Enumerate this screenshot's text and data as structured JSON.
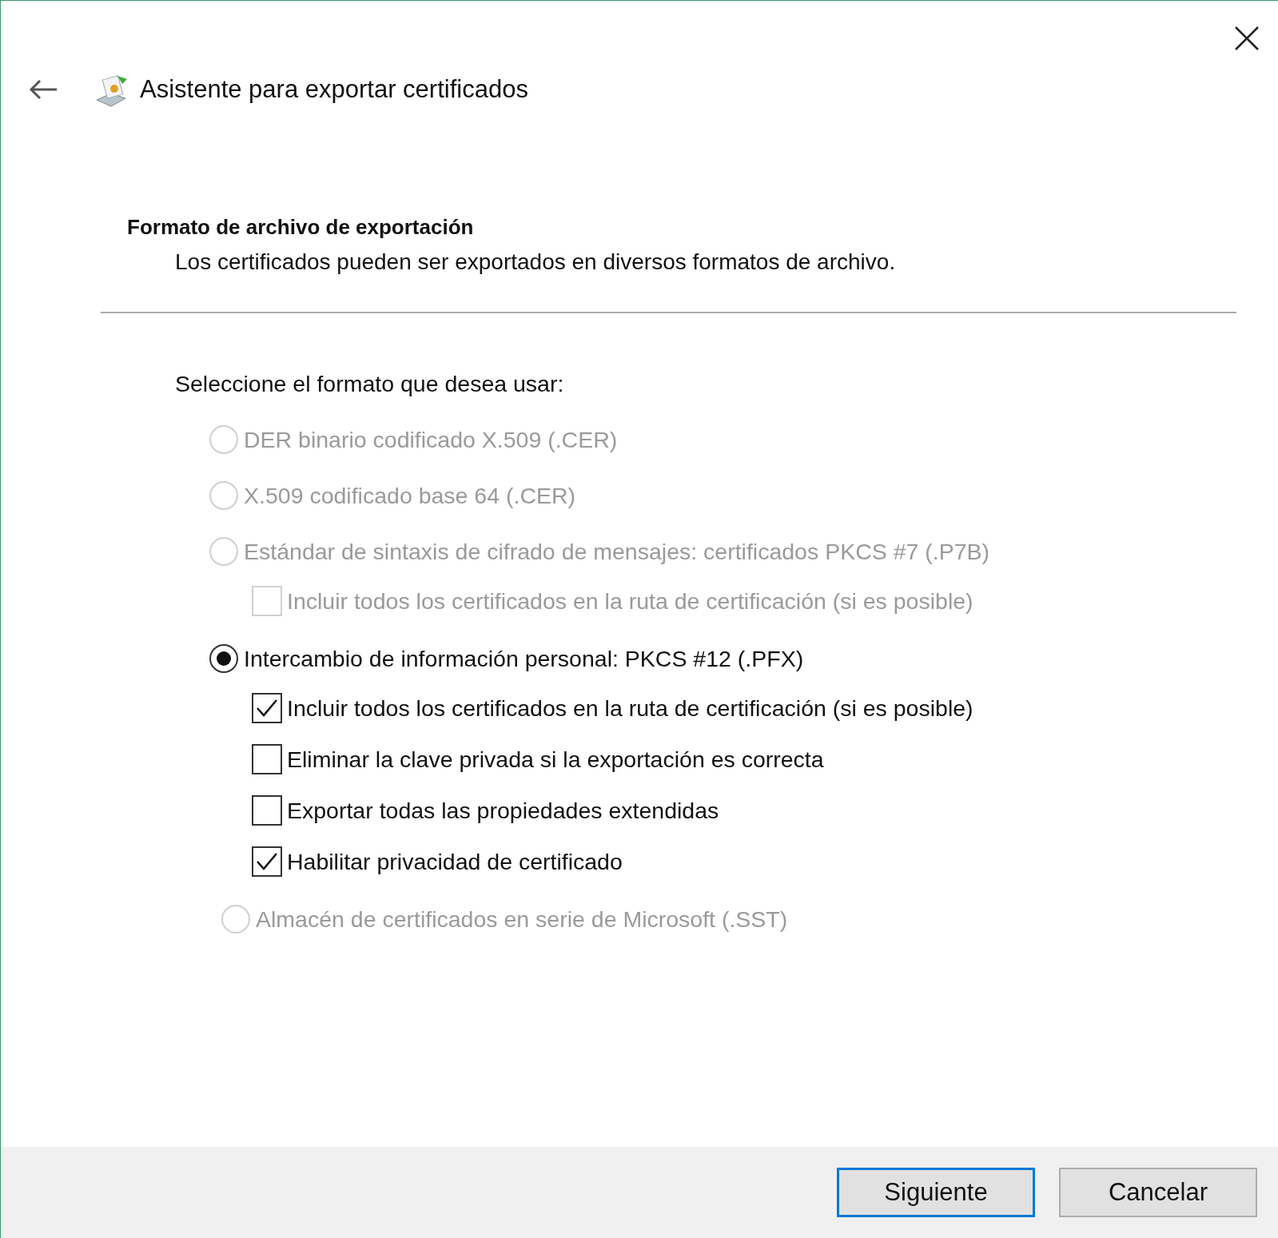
{
  "window": {
    "title": "Asistente para exportar certificados"
  },
  "header": {
    "title": "Formato de archivo de exportación",
    "subtitle": "Los certificados pueden ser exportados en diversos formatos de archivo."
  },
  "prompt": "Seleccione el formato que desea usar:",
  "options": [
    {
      "kind": "radio",
      "label": "DER binario codificado X.509 (.CER)",
      "selected": false,
      "disabled": true
    },
    {
      "kind": "radio",
      "label": "X.509 codificado base 64 (.CER)",
      "selected": false,
      "disabled": true
    },
    {
      "kind": "radio",
      "label": "Estándar de sintaxis de cifrado de mensajes: certificados PKCS #7 (.P7B)",
      "selected": false,
      "disabled": true,
      "children": [
        {
          "kind": "checkbox",
          "label": "Incluir todos los certificados en la ruta de certificación (si es posible)",
          "checked": false,
          "disabled": true
        }
      ]
    },
    {
      "kind": "radio",
      "label": "Intercambio de información personal: PKCS #12 (.PFX)",
      "selected": true,
      "disabled": false,
      "children": [
        {
          "kind": "checkbox",
          "label": "Incluir todos los certificados en la ruta de certificación (si es posible)",
          "checked": true,
          "disabled": false
        },
        {
          "kind": "checkbox",
          "label": "Eliminar la clave privada si la exportación es correcta",
          "checked": false,
          "disabled": false
        },
        {
          "kind": "checkbox",
          "label": "Exportar todas las propiedades extendidas",
          "checked": false,
          "disabled": false
        },
        {
          "kind": "checkbox",
          "label": "Habilitar privacidad de certificado",
          "checked": true,
          "disabled": false
        }
      ]
    },
    {
      "kind": "radio",
      "label": "Almacén de certificados en serie de Microsoft (.SST)",
      "selected": false,
      "disabled": true
    }
  ],
  "buttons": [
    {
      "label": "Siguiente",
      "default": true
    },
    {
      "label": "Cancelar",
      "default": false
    }
  ]
}
